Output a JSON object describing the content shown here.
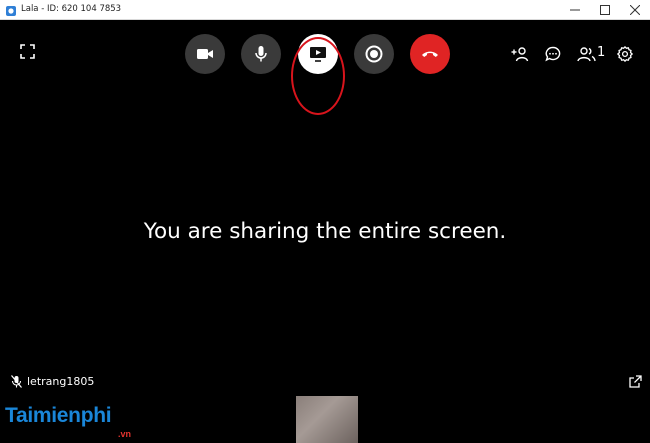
{
  "window": {
    "title": "Lala - ID: 620 104 7853",
    "controls": [
      "minimize-icon",
      "maximize-icon",
      "close-icon"
    ]
  },
  "toolbar": {
    "left": [
      "fullscreen-icon"
    ],
    "center": [
      {
        "name": "camera-button",
        "icon": "video-camera-icon",
        "style": "gray"
      },
      {
        "name": "microphone-button",
        "icon": "microphone-icon",
        "style": "gray"
      },
      {
        "name": "share-screen-button",
        "icon": "screen-share-icon",
        "style": "white",
        "active": true
      },
      {
        "name": "record-button",
        "icon": "record-icon",
        "style": "gray"
      },
      {
        "name": "end-call-button",
        "icon": "hang-up-icon",
        "style": "red"
      }
    ],
    "right": [
      "add-participant-icon",
      "chat-icon",
      "participants-icon",
      "settings-icon"
    ],
    "participants_count": "1"
  },
  "main": {
    "message": "You are sharing the entire screen."
  },
  "self_view": {
    "name": "letrang1805",
    "mic_state": "mic-muted-icon"
  },
  "watermark": {
    "text": "Taimienphi",
    "suffix": ".vn"
  },
  "colors": {
    "background": "#000000",
    "end_call": "#e02424",
    "highlight": "#d8141c",
    "watermark": "#1a86d8"
  }
}
